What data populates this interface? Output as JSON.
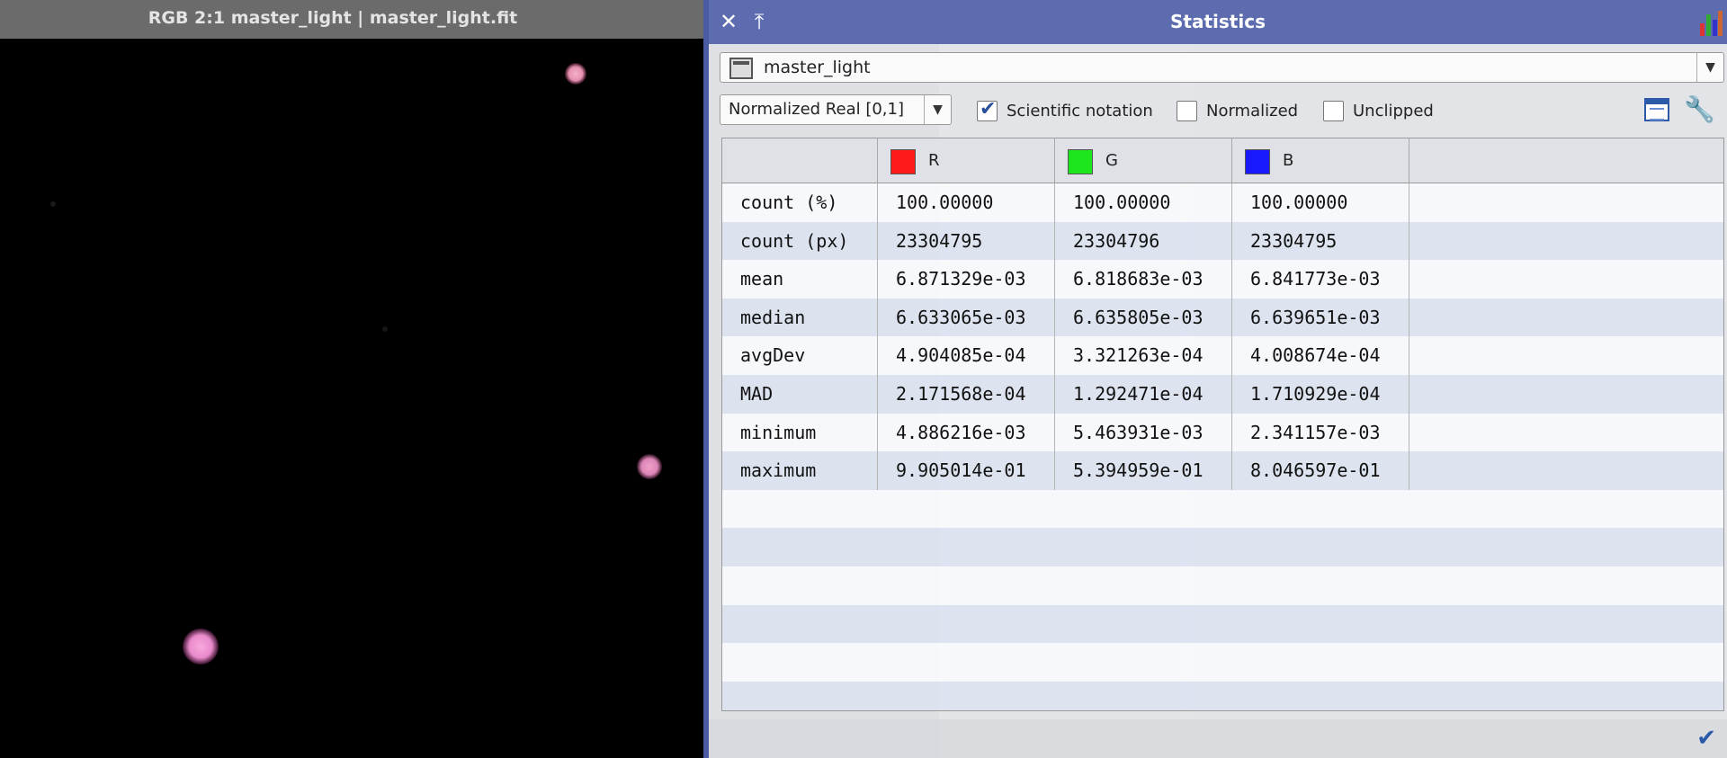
{
  "image_window": {
    "title": "RGB 2:1 master_light | master_light.fit"
  },
  "statistics": {
    "title": "Statistics",
    "image": "master_light",
    "notation": "Normalized Real [0,1]",
    "options": {
      "scientific_notation": {
        "label": "Scientific notation",
        "checked": true
      },
      "normalized": {
        "label": "Normalized",
        "checked": false
      },
      "unclipped": {
        "label": "Unclipped",
        "checked": false
      }
    },
    "channels": [
      {
        "label": "R",
        "color": "#ff1a1a"
      },
      {
        "label": "G",
        "color": "#1ee61e"
      },
      {
        "label": "B",
        "color": "#1a1aff"
      }
    ],
    "rows": [
      {
        "label": "count (%)",
        "values": [
          "100.00000",
          "100.00000",
          "100.00000"
        ]
      },
      {
        "label": "count (px)",
        "values": [
          "23304795",
          "23304796",
          "23304795"
        ]
      },
      {
        "label": "mean",
        "values": [
          "6.871329e-03",
          "6.818683e-03",
          "6.841773e-03"
        ]
      },
      {
        "label": "median",
        "values": [
          "6.633065e-03",
          "6.635805e-03",
          "6.639651e-03"
        ]
      },
      {
        "label": "avgDev",
        "values": [
          "4.904085e-04",
          "3.321263e-04",
          "4.008674e-04"
        ]
      },
      {
        "label": "MAD",
        "values": [
          "2.171568e-04",
          "1.292471e-04",
          "1.710929e-04"
        ]
      },
      {
        "label": "minimum",
        "values": [
          "4.886216e-03",
          "5.463931e-03",
          "2.341157e-03"
        ]
      },
      {
        "label": "maximum",
        "values": [
          "9.905014e-01",
          "5.394959e-01",
          "8.046597e-01"
        ]
      }
    ]
  },
  "colors": {
    "title_bar": "#5d6cae",
    "row_alt": "#d6ddee",
    "star": "#e58fc7"
  },
  "icons": [
    "close-icon",
    "shade-icon",
    "statistics-tool-icon",
    "image-icon",
    "chevron-down-icon",
    "checkmark-icon",
    "report-icon",
    "wrench-icon",
    "ok-check-icon"
  ]
}
